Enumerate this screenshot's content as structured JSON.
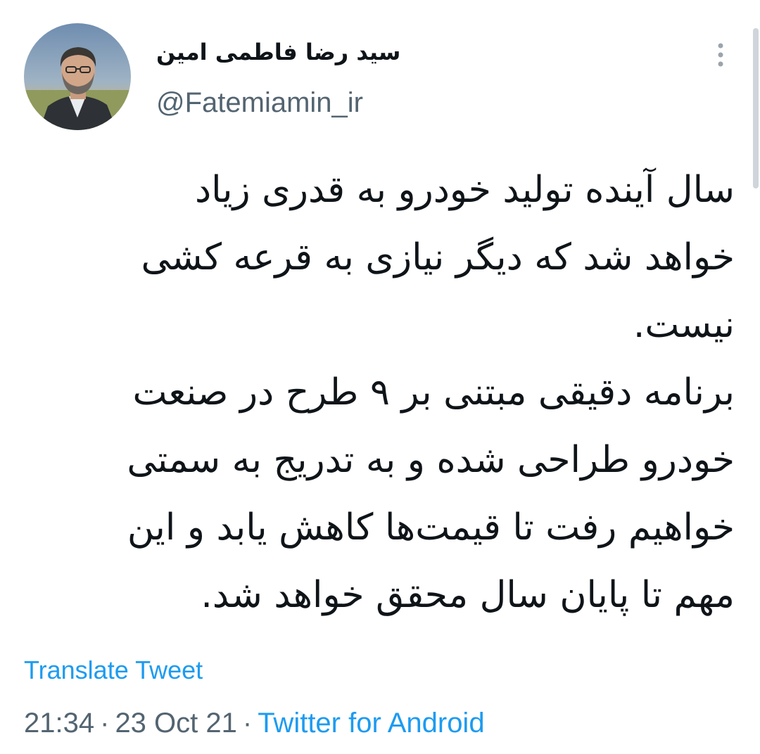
{
  "author": {
    "display_name": "سید رضا فاطمی امین",
    "handle": "@Fatemiamin_ir",
    "avatar_icon": "profile-photo"
  },
  "more_icon": "more-vertical-icon",
  "tweet": {
    "lines": [
      "سال آینده تولید خودرو به قدری زیاد",
      "خواهد شد که دیگر نیازی به قرعه کشی",
      "نیست.",
      "برنامه دقیقی مبتنی بر ۹ طرح در صنعت",
      "خودرو طراحی شده و به تدریج به سمتی",
      "خواهیم رفت تا قیمت‌ها کاهش یابد و این",
      "مهم تا پایان سال محقق خواهد شد."
    ]
  },
  "translate_label": "Translate Tweet",
  "meta": {
    "time": "21:34",
    "separator": "·",
    "date": "23 Oct 21",
    "source": "Twitter for Android"
  },
  "colors": {
    "link": "#1d9bf0",
    "secondary": "#536471",
    "text": "#0f1419"
  }
}
